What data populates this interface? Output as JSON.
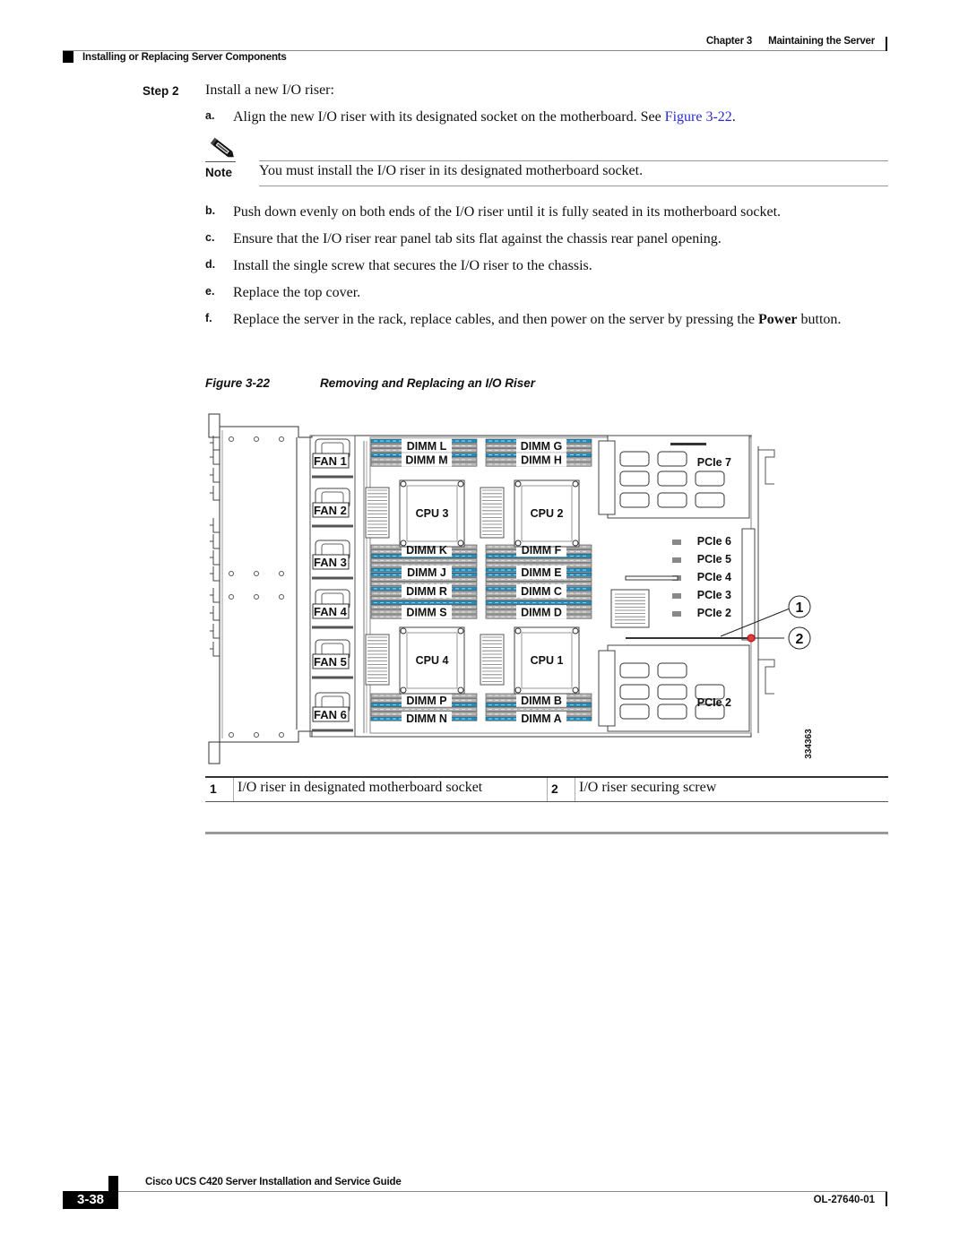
{
  "header": {
    "chapter": "Chapter 3",
    "chapter_title": "Maintaining the Server",
    "section": "Installing or Replacing Server Components"
  },
  "step": {
    "label": "Step 2",
    "text": "Install a new I/O riser:"
  },
  "substeps": [
    {
      "marker": "a.",
      "text": "Align the new I/O riser with its designated socket on the motherboard. See ",
      "link": "Figure 3-22",
      "after": "."
    },
    {
      "marker": "b.",
      "text": "Push down evenly on both ends of the I/O riser until it is fully seated in its motherboard socket."
    },
    {
      "marker": "c.",
      "text": "Ensure that the I/O riser rear panel tab sits flat against the chassis rear panel opening."
    },
    {
      "marker": "d.",
      "text": "Install the single screw that secures the I/O riser to the chassis."
    },
    {
      "marker": "e.",
      "text": "Replace the top cover."
    },
    {
      "marker": "f.",
      "text_before": "Replace the server in the rack, replace cables, and then power on the server by pressing the ",
      "bold": "Power",
      "text_after": " button."
    }
  ],
  "note": {
    "icon": "pencil-icon",
    "label": "Note",
    "text": "You must install the I/O riser in its designated motherboard socket."
  },
  "figure": {
    "number": "Figure 3-22",
    "title": "Removing and Replacing an I/O Riser",
    "art_id": "334363",
    "fans": [
      "FAN 1",
      "FAN 2",
      "FAN 3",
      "FAN 4",
      "FAN 5",
      "FAN 6"
    ],
    "cpus": [
      "CPU 3",
      "CPU 2",
      "CPU 4",
      "CPU 1"
    ],
    "dimms": {
      "top_left": [
        "DIMM L",
        "DIMM M"
      ],
      "top_right": [
        "DIMM G",
        "DIMM H"
      ],
      "mid_left": [
        "DIMM K",
        "DIMM J",
        "DIMM R",
        "DIMM S"
      ],
      "mid_right": [
        "DIMM F",
        "DIMM E",
        "DIMM C",
        "DIMM D"
      ],
      "bot_left": [
        "DIMM P",
        "DIMM N"
      ],
      "bot_right": [
        "DIMM B",
        "DIMM A"
      ]
    },
    "pcie_top_riser": "PCIe 7",
    "pcie_slots": [
      "PCIe 6",
      "PCIe 5",
      "PCIe 4",
      "PCIe 3",
      "PCIe 2"
    ],
    "pcie_bottom_riser": "PCIe 2",
    "callouts": [
      "1",
      "2"
    ],
    "colors": {
      "dimm_blue": "#1e8fc0",
      "dimm_gray": "#b8b8b8",
      "screw_red": "#e23b3b"
    }
  },
  "legend": [
    {
      "num": "1",
      "text": "I/O riser in designated motherboard socket"
    },
    {
      "num": "2",
      "text": "I/O riser securing screw"
    }
  ],
  "footer": {
    "guide_title": "Cisco UCS C420 Server Installation and Service Guide",
    "page": "3-38",
    "doc_id": "OL-27640-01"
  }
}
